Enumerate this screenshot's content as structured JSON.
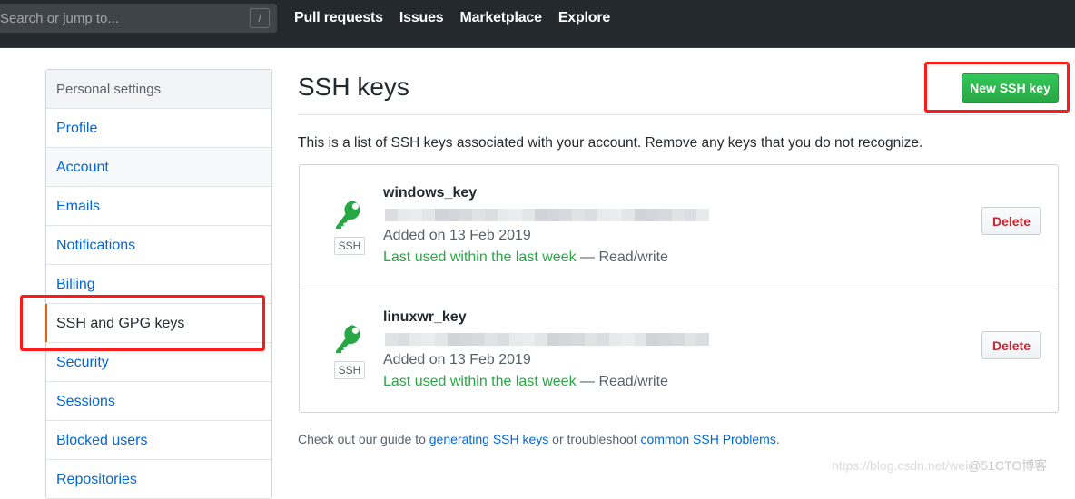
{
  "header": {
    "search": {
      "placeholder": "Search or jump to...",
      "value": "",
      "shortcut": "/"
    },
    "nav": [
      "Pull requests",
      "Issues",
      "Marketplace",
      "Explore"
    ]
  },
  "sidebar": {
    "heading": "Personal settings",
    "items": [
      {
        "label": "Profile",
        "state": "default"
      },
      {
        "label": "Account",
        "state": "hover"
      },
      {
        "label": "Emails",
        "state": "default"
      },
      {
        "label": "Notifications",
        "state": "default"
      },
      {
        "label": "Billing",
        "state": "default"
      },
      {
        "label": "SSH and GPG keys",
        "state": "selected"
      },
      {
        "label": "Security",
        "state": "default"
      },
      {
        "label": "Sessions",
        "state": "default"
      },
      {
        "label": "Blocked users",
        "state": "default"
      },
      {
        "label": "Repositories",
        "state": "default"
      }
    ]
  },
  "main": {
    "title": "SSH keys",
    "new_button": "New SSH key",
    "intro": "This is a list of SSH keys associated with your account. Remove any keys that you do not recognize.",
    "keys": [
      {
        "name": "windows_key",
        "badge": "SSH",
        "fingerprint_redacted": true,
        "added": "Added on 13 Feb 2019",
        "last_used": "Last used within the last week",
        "access": " — Read/write",
        "delete_label": "Delete"
      },
      {
        "name": "linuxwr_key",
        "badge": "SSH",
        "fingerprint_redacted": true,
        "added": "Added on 13 Feb 2019",
        "last_used": "Last used within the last week",
        "access": " — Read/write",
        "delete_label": "Delete"
      }
    ],
    "footer": {
      "prefix": "Check out our guide to ",
      "link1": "generating SSH keys",
      "middle": " or troubleshoot ",
      "link2": "common SSH Problems",
      "suffix": "."
    }
  },
  "watermark": {
    "url": "https://blog.csdn.net/wei",
    "brand": "@51CTO博客"
  },
  "colors": {
    "header_bg": "#24292e",
    "link": "#0366d6",
    "primary_button": "#28a745",
    "danger": "#cb2431",
    "selected_accent": "#e36209",
    "annotation": "#ff1a1a"
  }
}
